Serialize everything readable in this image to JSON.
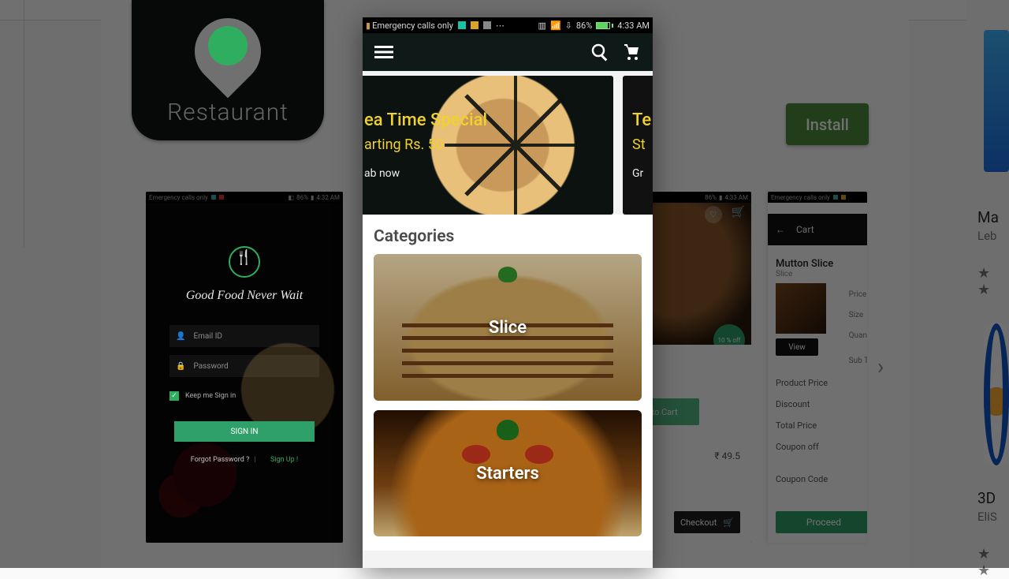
{
  "install_label": "Install",
  "app_tile_label": "Restaurant",
  "right_cards": {
    "a": {
      "title": "Ma",
      "subtitle": "Leb",
      "stars": "★ ★"
    },
    "b": {
      "title": "3D",
      "subtitle": "EliS",
      "stars": "★ ★"
    }
  },
  "shot1": {
    "status": {
      "left": "Emergency calls only",
      "battery": "86%",
      "time": "4:32 AM"
    },
    "tagline": "Good Food Never Wait",
    "email_placeholder": "Email ID",
    "password_placeholder": "Password",
    "keep_label": "Keep me Sign in",
    "signin_label": "SIGN IN",
    "forgot_label": "Forgot Password ?",
    "signup_label": "Sign Up !"
  },
  "shot3": {
    "status": {
      "left": "",
      "battery": "86%",
      "time": "4:33 AM"
    },
    "badge": "10 % off",
    "addcart": "Add to Cart",
    "price": "₹ 49.5",
    "checkout": "Checkout"
  },
  "shot4": {
    "bar_title": "Cart",
    "item_name": "Mutton Slice",
    "item_sub": "Slice",
    "labels": [
      "Price",
      "Size",
      "Quan",
      "Sub T"
    ],
    "view": "View",
    "rows": [
      "Product Price",
      "Discount",
      "Total Price",
      "Coupon off",
      "Coupon Code"
    ],
    "proceed": "Proceed"
  },
  "fg": {
    "status": {
      "left": "Emergency calls only",
      "battery_pct": "86%",
      "time": "4:33 AM"
    },
    "promo1": {
      "title": "ea Time Special",
      "sub": "arting Rs. 50",
      "cta": "ab now"
    },
    "promo2": {
      "title": "Te",
      "sub": "St",
      "cta": "Gr"
    },
    "section_title": "Categories",
    "cat1": "Slice",
    "cat2": "Starters"
  }
}
